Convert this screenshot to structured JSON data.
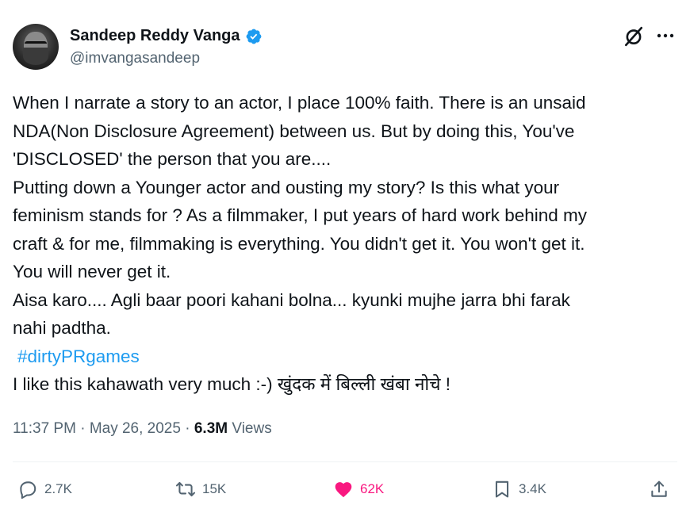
{
  "author": {
    "display_name": "Sandeep Reddy Vanga",
    "handle": "@imvangasandeep",
    "verified": true,
    "verified_color": "#1d9bf0"
  },
  "tweet": {
    "lines": [
      "When I narrate a story to an actor, I place 100% faith. There is an unsaid",
      "NDA(Non Disclosure Agreement) between us. But by doing this, You've",
      "'DISCLOSED' the person that you are....",
      "Putting down a Younger actor and ousting my story?  Is this what your",
      "feminism stands for ? As a filmmaker, I put years of hard work behind my",
      "craft & for me, filmmaking is everything. You didn't get it. You won't get it.",
      "You will never get it.",
      "Aisa karo.... Agli baar poori kahani bolna... kyunki mujhe jarra bhi farak",
      "nahi padtha."
    ],
    "hashtag": "#dirtyPRgames",
    "last_line": "I like this kahawath very much :-) खुंदक में बिल्ली खंबा नोचे !"
  },
  "meta": {
    "time": "11:37 PM",
    "separator": " · ",
    "date": "May 26, 2025",
    "views_count": "6.3M",
    "views_label": " Views"
  },
  "actions": {
    "replies": "2.7K",
    "reposts": "15K",
    "likes": "62K",
    "bookmarks": "3.4K"
  },
  "icons": [
    "grok-icon",
    "more-icon",
    "verified-badge-icon",
    "reply-icon",
    "repost-icon",
    "like-icon",
    "bookmark-icon",
    "share-icon"
  ],
  "colors": {
    "text": "#0f1419",
    "secondary": "#536471",
    "link": "#1d9bf0",
    "like": "#f91880"
  }
}
